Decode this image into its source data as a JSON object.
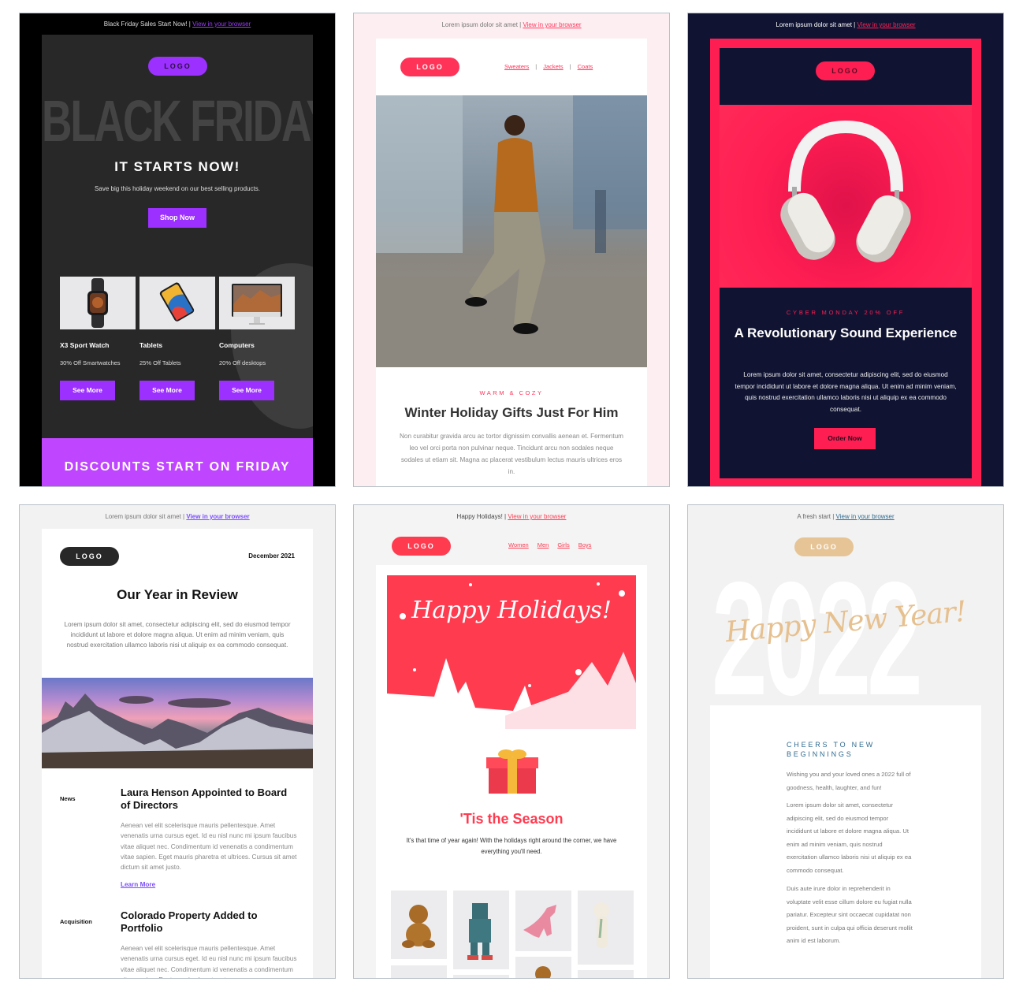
{
  "black_friday": {
    "preheader_text": "Black Friday Sales Start Now! | ",
    "preheader_link": "View in your browser",
    "logo": "LOGO",
    "big_word": "BLACK FRIDAY",
    "title": "IT STARTS NOW!",
    "subtitle": "Save big this holiday weekend on our best selling products.",
    "cta": "Shop Now",
    "products": [
      {
        "name": "X3 Sport Watch",
        "desc": "30% Off Smartwatches",
        "button": "See More",
        "image": "smartwatch"
      },
      {
        "name": "Tablets",
        "desc": "25% Off Tablets",
        "button": "See More",
        "image": "tablet"
      },
      {
        "name": "Computers",
        "desc": "20% Off desktops",
        "button": "See More",
        "image": "desktop-computer"
      }
    ],
    "banner": "DISCOUNTS START ON FRIDAY",
    "colors": {
      "accent": "#9b30ff",
      "banner": "#bf45ff",
      "panel": "#282828"
    }
  },
  "winter": {
    "preheader_text": "Lorem ipsum dolor sit amet | ",
    "preheader_link": "View in your browser",
    "logo": "LOGO",
    "nav": [
      "Sweaters",
      "Jackets",
      "Coats"
    ],
    "nav_separator": "|",
    "eyebrow": "WARM & COZY",
    "title": "Winter Holiday Gifts Just For Him",
    "body": "Non curabitur gravida arcu ac tortor dignissim convallis aenean et. Fermentum leo vel orci porta non pulvinar neque. Tincidunt arcu non sodales neque sodales ut etiam sit. Magna ac placerat vestibulum lectus mauris ultrices eros in.",
    "colors": {
      "accent": "#ff3358",
      "background": "#fdeff1"
    }
  },
  "cyber_monday": {
    "preheader_text": "Lorem ipsum dolor sit amet | ",
    "preheader_link": "View in your browser",
    "logo": "LOGO",
    "eyebrow": "CYBER MONDAY 20% OFF",
    "title": "A Revolutionary Sound Experience",
    "body": "Lorem ipsum dolor sit amet, consectetur adipiscing elit, sed do eiusmod tempor incididunt ut labore et dolore magna aliqua. Ut enim ad minim veniam, quis nostrud exercitation ullamco laboris nisi ut aliquip ex ea commodo consequat.",
    "cta": "Order Now",
    "colors": {
      "accent": "#ff1e52",
      "navy": "#101432"
    }
  },
  "year_review": {
    "preheader_text": "Lorem ipsum dolor sit amet | ",
    "preheader_link": "View in your browser",
    "logo": "LOGO",
    "date": "December 2021",
    "title": "Our Year in Review",
    "intro": "Lorem ipsum dolor sit amet, consectetur adipiscing elit, sed do eiusmod tempor incididunt ut labore et dolore magna aliqua. Ut enim ad minim veniam, quis nostrud exercitation ullamco laboris nisi ut aliquip ex ea commodo consequat.",
    "articles": [
      {
        "category": "News",
        "headline": "Laura Henson Appointed to Board of Directors",
        "body": "Aenean vel elit scelerisque mauris pellentesque. Amet venenatis urna cursus eget. Id eu nisl nunc mi ipsum faucibus vitae aliquet nec. Condimentum id venenatis a condimentum vitae sapien. Eget mauris pharetra et ultrices. Cursus sit amet dictum sit amet justo.",
        "link": "Learn More"
      },
      {
        "category": "Acquisition",
        "headline": "Colorado Property Added to Portfolio",
        "body": "Aenean vel elit scelerisque mauris pellentesque. Amet venenatis urna cursus eget. Id eu nisl nunc mi ipsum faucibus vitae aliquet nec. Condimentum id venenatis a condimentum vitae sapien. Eget mauris pharetra et"
      }
    ],
    "colors": {
      "link": "#7b4dff"
    }
  },
  "holidays": {
    "preheader_text": "Happy Holidays! | ",
    "preheader_link": "View in your browser",
    "logo": "LOGO",
    "nav": [
      "Women",
      "Men",
      "Girls",
      "Boys"
    ],
    "banner_script": "Happy Holidays!",
    "title": "'Tis the Season",
    "body": "It's that time of year again! With the holidays right around the corner, we have everything you'll need.",
    "toys": [
      "teddy-bear",
      "robot",
      "dinosaur",
      "plush-bear",
      "toy",
      "toy",
      "teddy-bear",
      "toy"
    ],
    "colors": {
      "accent": "#ff3b50"
    }
  },
  "new_year": {
    "preheader_text": "A fresh start | ",
    "preheader_link": "View in your browser",
    "logo": "LOGO",
    "big_year": "2022",
    "script": "Happy New Year!",
    "eyebrow": "CHEERS TO NEW BEGINNINGS",
    "paragraphs": [
      "Wishing you and your loved ones a 2022 full of goodness, health, laughter, and fun!",
      "Lorem ipsum dolor sit amet, consectetur adipiscing elit, sed do eiusmod tempor incididunt ut labore et dolore magna aliqua. Ut enim ad minim veniam, quis nostrud exercitation ullamco laboris nisi ut aliquip ex ea commodo consequat.",
      "Duis aute irure dolor in reprehenderit in voluptate velit esse cillum dolore eu fugiat nulla pariatur. Excepteur sint occaecat cupidatat non proident, sunt in culpa qui officia deserunt mollit anim id est laborum."
    ],
    "colors": {
      "gold": "#e6c495",
      "blue": "#2f6a8f"
    }
  }
}
